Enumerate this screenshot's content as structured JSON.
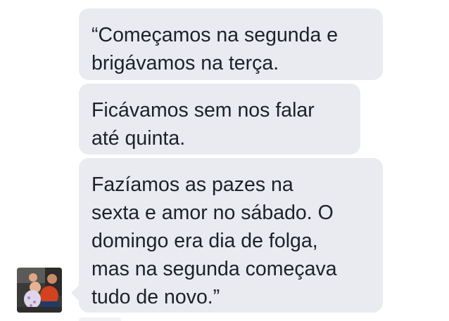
{
  "thread": {
    "messages": [
      {
        "lines": [
          "“Começamos na segunda e",
          "brigávamos na terça."
        ]
      },
      {
        "lines": [
          "Ficávamos sem nos falar",
          "até quinta."
        ]
      },
      {
        "lines": [
          "Fazíamos as pazes na",
          "sexta e amor no sábado. O",
          "domingo era dia de folga,",
          "mas na segunda começava",
          "tudo de novo.”"
        ]
      }
    ],
    "avatar": {
      "icon": "profile-photo-icon"
    }
  },
  "colors": {
    "bubble_background": "#e9ebf0",
    "text": "#1d2129",
    "page_background": "#ffffff"
  }
}
